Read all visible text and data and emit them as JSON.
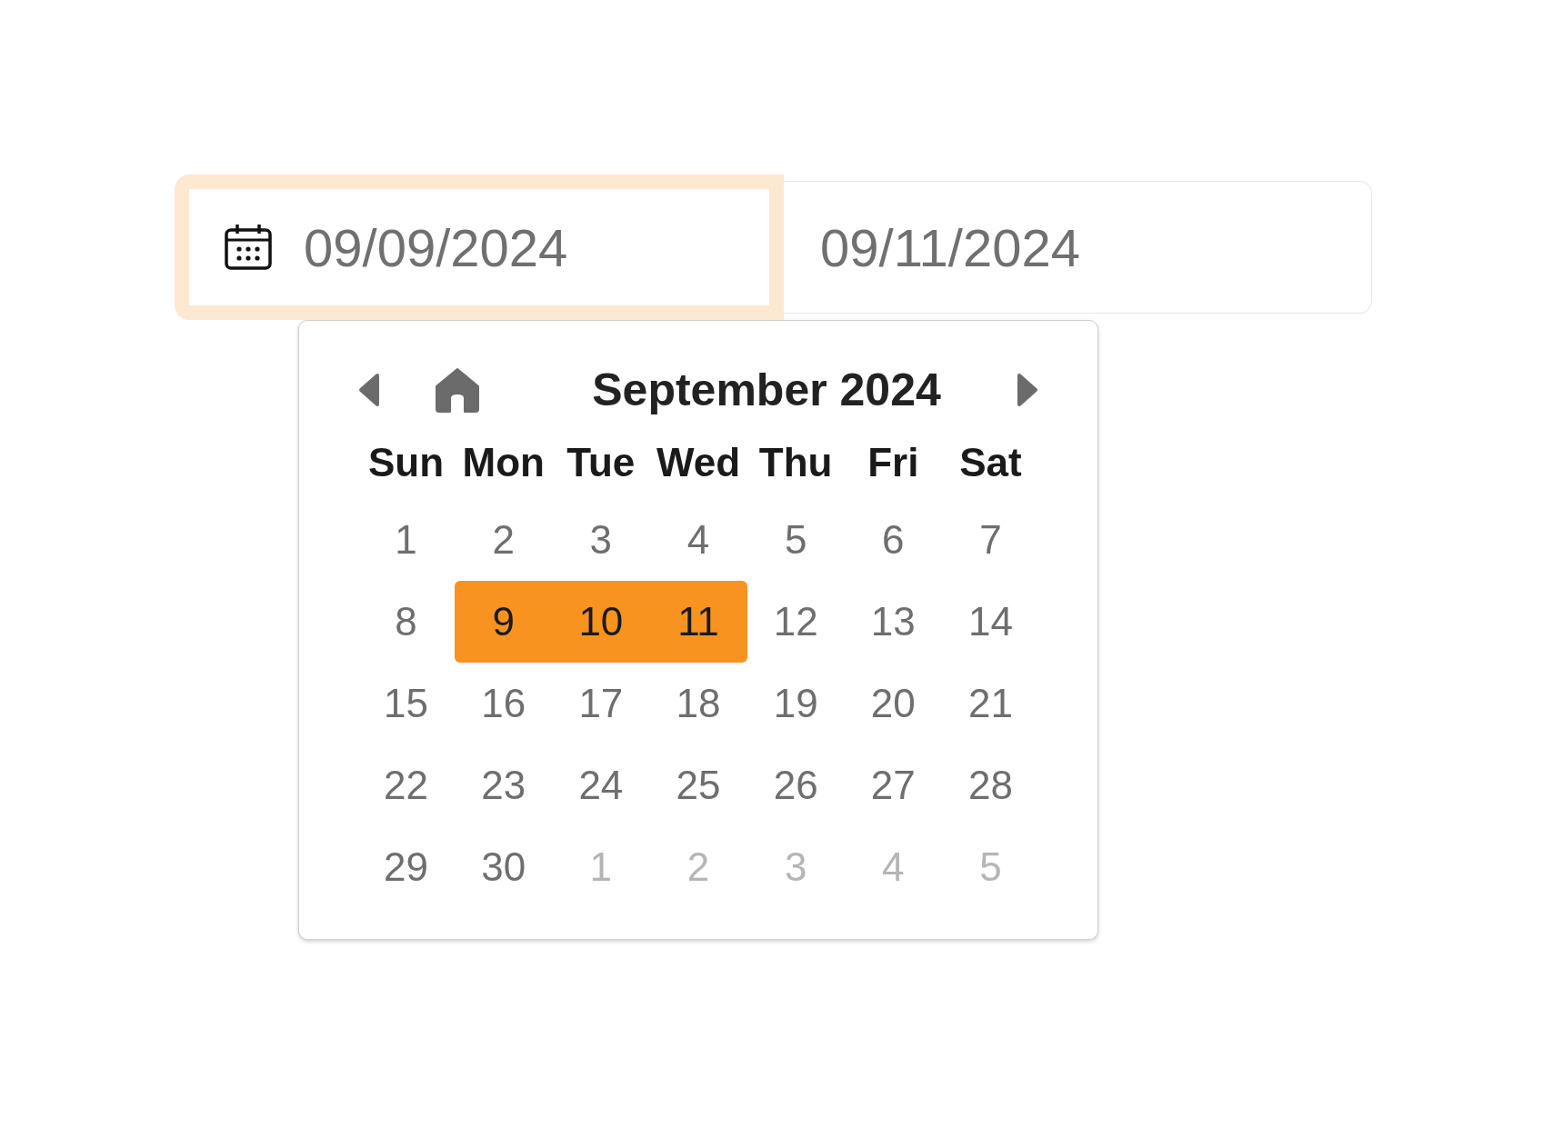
{
  "inputs": [
    {
      "value": "09/09/2024",
      "focused": true,
      "icon": true
    },
    {
      "value": "09/11/2024",
      "focused": false,
      "icon": false
    }
  ],
  "calendar": {
    "title": "September 2024",
    "weekdays": [
      "Sun",
      "Mon",
      "Tue",
      "Wed",
      "Thu",
      "Fri",
      "Sat"
    ],
    "weeks": [
      [
        {
          "label": "1",
          "outside": false,
          "selected": false
        },
        {
          "label": "2",
          "outside": false,
          "selected": false
        },
        {
          "label": "3",
          "outside": false,
          "selected": false
        },
        {
          "label": "4",
          "outside": false,
          "selected": false
        },
        {
          "label": "5",
          "outside": false,
          "selected": false
        },
        {
          "label": "6",
          "outside": false,
          "selected": false
        },
        {
          "label": "7",
          "outside": false,
          "selected": false
        }
      ],
      [
        {
          "label": "8",
          "outside": false,
          "selected": false
        },
        {
          "label": "9",
          "outside": false,
          "selected": true
        },
        {
          "label": "10",
          "outside": false,
          "selected": true
        },
        {
          "label": "11",
          "outside": false,
          "selected": true
        },
        {
          "label": "12",
          "outside": false,
          "selected": false
        },
        {
          "label": "13",
          "outside": false,
          "selected": false
        },
        {
          "label": "14",
          "outside": false,
          "selected": false
        }
      ],
      [
        {
          "label": "15",
          "outside": false,
          "selected": false
        },
        {
          "label": "16",
          "outside": false,
          "selected": false
        },
        {
          "label": "17",
          "outside": false,
          "selected": false
        },
        {
          "label": "18",
          "outside": false,
          "selected": false
        },
        {
          "label": "19",
          "outside": false,
          "selected": false
        },
        {
          "label": "20",
          "outside": false,
          "selected": false
        },
        {
          "label": "21",
          "outside": false,
          "selected": false
        }
      ],
      [
        {
          "label": "22",
          "outside": false,
          "selected": false
        },
        {
          "label": "23",
          "outside": false,
          "selected": false
        },
        {
          "label": "24",
          "outside": false,
          "selected": false
        },
        {
          "label": "25",
          "outside": false,
          "selected": false
        },
        {
          "label": "26",
          "outside": false,
          "selected": false
        },
        {
          "label": "27",
          "outside": false,
          "selected": false
        },
        {
          "label": "28",
          "outside": false,
          "selected": false
        }
      ],
      [
        {
          "label": "29",
          "outside": false,
          "selected": false
        },
        {
          "label": "30",
          "outside": false,
          "selected": false
        },
        {
          "label": "1",
          "outside": true,
          "selected": false
        },
        {
          "label": "2",
          "outside": true,
          "selected": false
        },
        {
          "label": "3",
          "outside": true,
          "selected": false
        },
        {
          "label": "4",
          "outside": true,
          "selected": false
        },
        {
          "label": "5",
          "outside": true,
          "selected": false
        }
      ]
    ]
  }
}
